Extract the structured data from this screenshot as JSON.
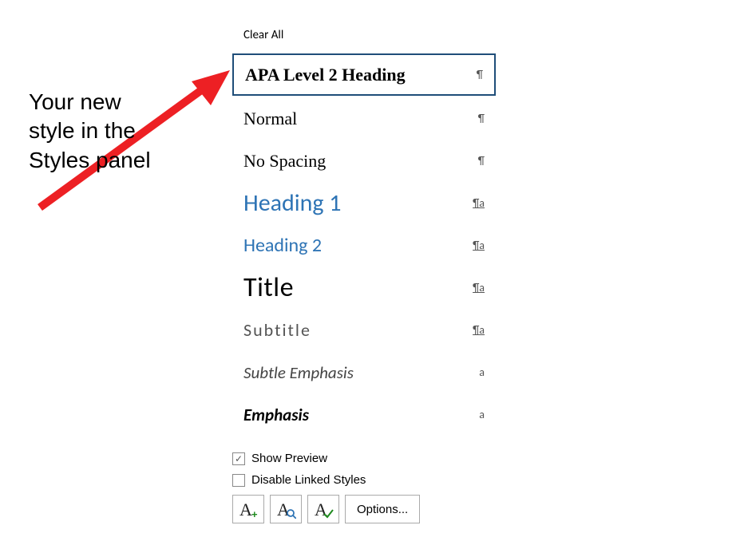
{
  "annotation": {
    "line1": "Your new",
    "line2": "style in the",
    "line3": "Styles panel"
  },
  "panel": {
    "clear_all": "Clear All",
    "styles": [
      {
        "label": "APA Level 2 Heading",
        "marker": "¶",
        "marker_underline": false,
        "preview_class": "lbl-apa",
        "highlighted": true,
        "name": "style-item-apa-level-2-heading"
      },
      {
        "label": "Normal",
        "marker": "¶",
        "marker_underline": false,
        "preview_class": "lbl-normal",
        "highlighted": false,
        "name": "style-item-normal"
      },
      {
        "label": "No Spacing",
        "marker": "¶",
        "marker_underline": false,
        "preview_class": "lbl-nospacing",
        "highlighted": false,
        "name": "style-item-no-spacing"
      },
      {
        "label": "Heading 1",
        "marker": "¶a",
        "marker_underline": true,
        "preview_class": "lbl-h1",
        "highlighted": false,
        "name": "style-item-heading-1"
      },
      {
        "label": "Heading 2",
        "marker": "¶a",
        "marker_underline": true,
        "preview_class": "lbl-h2",
        "highlighted": false,
        "name": "style-item-heading-2"
      },
      {
        "label": "Title",
        "marker": "¶a",
        "marker_underline": true,
        "preview_class": "lbl-title",
        "highlighted": false,
        "name": "style-item-title"
      },
      {
        "label": "Subtitle",
        "marker": "¶a",
        "marker_underline": true,
        "preview_class": "lbl-subtitle",
        "highlighted": false,
        "name": "style-item-subtitle"
      },
      {
        "label": "Subtle Emphasis",
        "marker": "a",
        "marker_underline": false,
        "preview_class": "lbl-subtleemph",
        "highlighted": false,
        "name": "style-item-subtle-emphasis"
      },
      {
        "label": "Emphasis",
        "marker": "a",
        "marker_underline": false,
        "preview_class": "lbl-emph",
        "highlighted": false,
        "name": "style-item-emphasis"
      }
    ]
  },
  "footer": {
    "show_preview": "Show Preview",
    "show_preview_checked": true,
    "disable_linked": "Disable Linked Styles",
    "disable_linked_checked": false,
    "options": "Options..."
  }
}
